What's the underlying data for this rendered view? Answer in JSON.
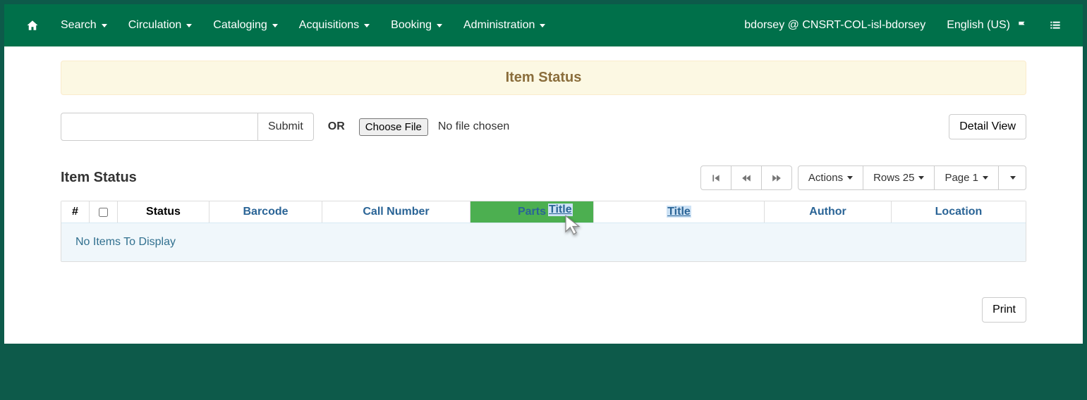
{
  "nav": {
    "items": [
      "Search",
      "Circulation",
      "Cataloging",
      "Acquisitions",
      "Booking",
      "Administration"
    ],
    "user": "bdorsey @ CNSRT-COL-isl-bdorsey",
    "lang": "English (US)"
  },
  "banner": {
    "title": "Item Status"
  },
  "form": {
    "submit": "Submit",
    "or": "OR",
    "choose": "Choose File",
    "nofile": "No file chosen",
    "detail": "Detail View"
  },
  "grid": {
    "title": "Item Status",
    "actions": "Actions",
    "rows": "Rows 25",
    "page": "Page 1",
    "empty": "No Items To Display",
    "cols": {
      "num": "#",
      "status": "Status",
      "barcode": "Barcode",
      "call": "Call Number",
      "parts": "Parts",
      "title": "Title",
      "author": "Author",
      "location": "Location"
    },
    "drag_label": "Title"
  },
  "print": "Print"
}
